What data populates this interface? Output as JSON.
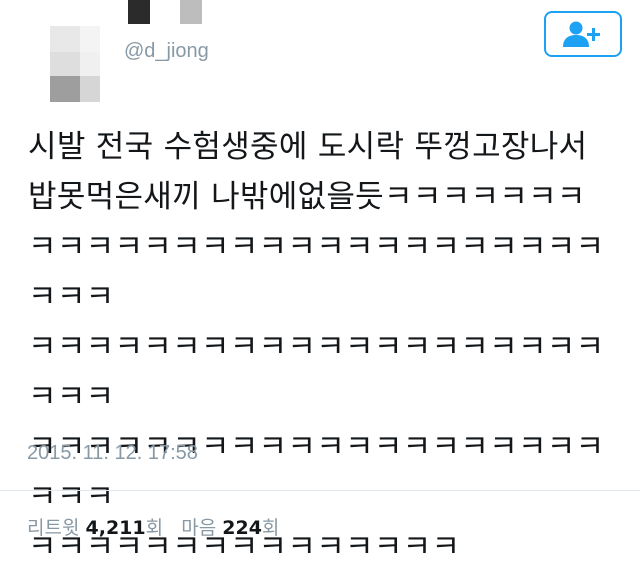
{
  "user": {
    "handle": "@d_jiong",
    "avatar_icon": "pixelated-avatar-icon"
  },
  "follow_button": {
    "icon": "add-user-icon",
    "color": "#1da1f2"
  },
  "tweet": {
    "text": "시발 전국 수험생중에 도시락 뚜껑고장나서\n밥못먹은새끼 나밖에없을듯ㅋㅋㅋㅋㅋㅋㅋ\nㅋㅋㅋㅋㅋㅋㅋㅋㅋㅋㅋㅋㅋㅋㅋㅋㅋㅋㅋㅋㅋㅋㅋ\nㅋㅋㅋㅋㅋㅋㅋㅋㅋㅋㅋㅋㅋㅋㅋㅋㅋㅋㅋㅋㅋㅋㅋ\nㅋㅋㅋㅋㅋㅋㅋㅋㅋㅋㅋㅋㅋㅋㅋㅋㅋㅋㅋㅋㅋㅋㅋ\nㅋㅋㅋㅋㅋㅋㅋㅋㅋㅋㅋㅋㅋㅋㅋ",
    "timestamp": "2015. 11. 12. 17:58"
  },
  "stats": {
    "retweet_label": "리트윗",
    "retweet_count": "4,211",
    "retweet_unit": "회",
    "like_label": "마음",
    "like_count": "224",
    "like_unit": "회"
  },
  "colors": {
    "accent": "#1da1f2",
    "secondary_text": "#8899a6",
    "primary_text": "#14171a"
  }
}
